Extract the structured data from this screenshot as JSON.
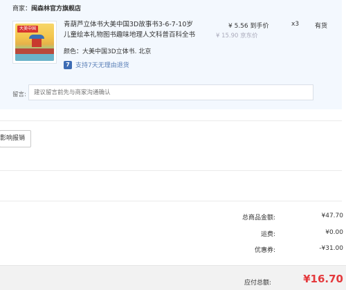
{
  "order": {
    "merchant_label": "商家：",
    "merchant_name": "闽森林官方旗舰店",
    "product": {
      "thumb_banner": "大美中国",
      "title": "青葫芦立体书大美中国3D故事书3-6-7-10岁儿童绘本礼物图书趣味地理人文科普百科全书",
      "price_now": "¥ 5.56 到手价",
      "price_old": "¥ 15.90 京东价",
      "quantity": "x3",
      "stock": "有货",
      "spec": "颜色：大美中国3D立体书. 北京",
      "return_badge": "7",
      "return_text": "支持7天无理由退货"
    },
    "message": {
      "label": "留言:",
      "placeholder": "建议留言前先与商家沟通确认"
    }
  },
  "invoice_button": "影响报销",
  "summary": {
    "total_label": "总商品金额:",
    "total_value": "¥47.70",
    "shipping_label": "运费:",
    "shipping_value": "¥0.00",
    "discount_label": "优惠券:",
    "discount_value": "-¥31.00"
  },
  "payment": {
    "label": "应付总额:",
    "value": "¥16.70"
  },
  "colors": {
    "accent_red": "#e4393c",
    "link_blue": "#5a7fb7",
    "panel_bg": "#f3f8fe"
  }
}
